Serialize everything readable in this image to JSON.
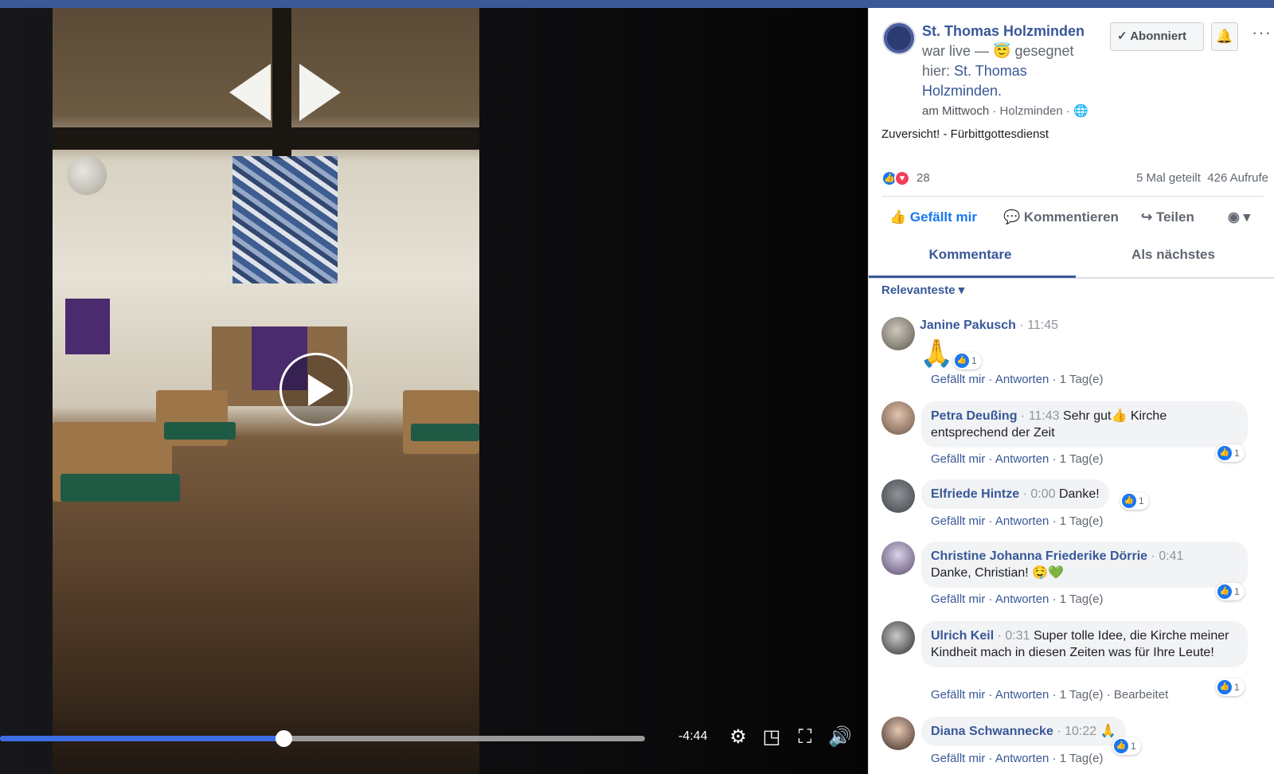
{
  "post": {
    "page_name": "St. Thomas Holzminden",
    "live_text": "war live —",
    "feeling_text": "gesegnet hier:",
    "location_name": "St. Thomas Holzminden.",
    "date": "am Mittwoch",
    "place": "Holzminden",
    "subscribe_label": "Abonniert",
    "text": "Zuversicht! - Fürbittgottesdienst"
  },
  "stats": {
    "reactions": "28",
    "shares": "5 Mal geteilt",
    "views": "426 Aufrufe"
  },
  "actions": {
    "like": "Gefällt mir",
    "comment": "Kommentieren",
    "share": "Teilen"
  },
  "tabs": {
    "comments": "Kommentare",
    "next": "Als nächstes"
  },
  "filter": "Relevanteste",
  "player": {
    "time_remaining": "-4:44",
    "progress": 0.44
  },
  "comments": [
    {
      "name": "Janine Pakusch",
      "time": "11:45",
      "text": "🙏",
      "reactions": "1",
      "like": "Gefällt mir",
      "reply": "Antworten",
      "age": "1 Tag(e)",
      "edited": ""
    },
    {
      "name": "Petra Deußing",
      "time": "11:43",
      "text": "Sehr gut👍 Kirche entsprechend der Zeit",
      "reactions": "1",
      "like": "Gefällt mir",
      "reply": "Antworten",
      "age": "1 Tag(e)",
      "edited": ""
    },
    {
      "name": "Elfriede Hintze",
      "time": "0:00",
      "text": "Danke!",
      "reactions": "1",
      "like": "Gefällt mir",
      "reply": "Antworten",
      "age": "1 Tag(e)",
      "edited": ""
    },
    {
      "name": "Christine Johanna Friederike Dörrie",
      "time": "0:41",
      "text": "Danke, Christian! 🤤💚",
      "reactions": "1",
      "like": "Gefällt mir",
      "reply": "Antworten",
      "age": "1 Tag(e)",
      "edited": ""
    },
    {
      "name": "Ulrich Keil",
      "time": "0:31",
      "text": "Super tolle Idee, die Kirche meiner Kindheit mach in diesen Zeiten was für Ihre Leute!",
      "reactions": "1",
      "like": "Gefällt mir",
      "reply": "Antworten",
      "age": "1 Tag(e)",
      "edited": "Bearbeitet"
    },
    {
      "name": "Diana Schwannecke",
      "time": "10:22",
      "text": "🙏",
      "reactions": "1",
      "like": "Gefällt mir",
      "reply": "Antworten",
      "age": "1 Tag(e)",
      "edited": ""
    }
  ],
  "colors": {
    "accent": "#385898",
    "like_blue": "#1877f2",
    "progress": "#3d6ee6"
  }
}
